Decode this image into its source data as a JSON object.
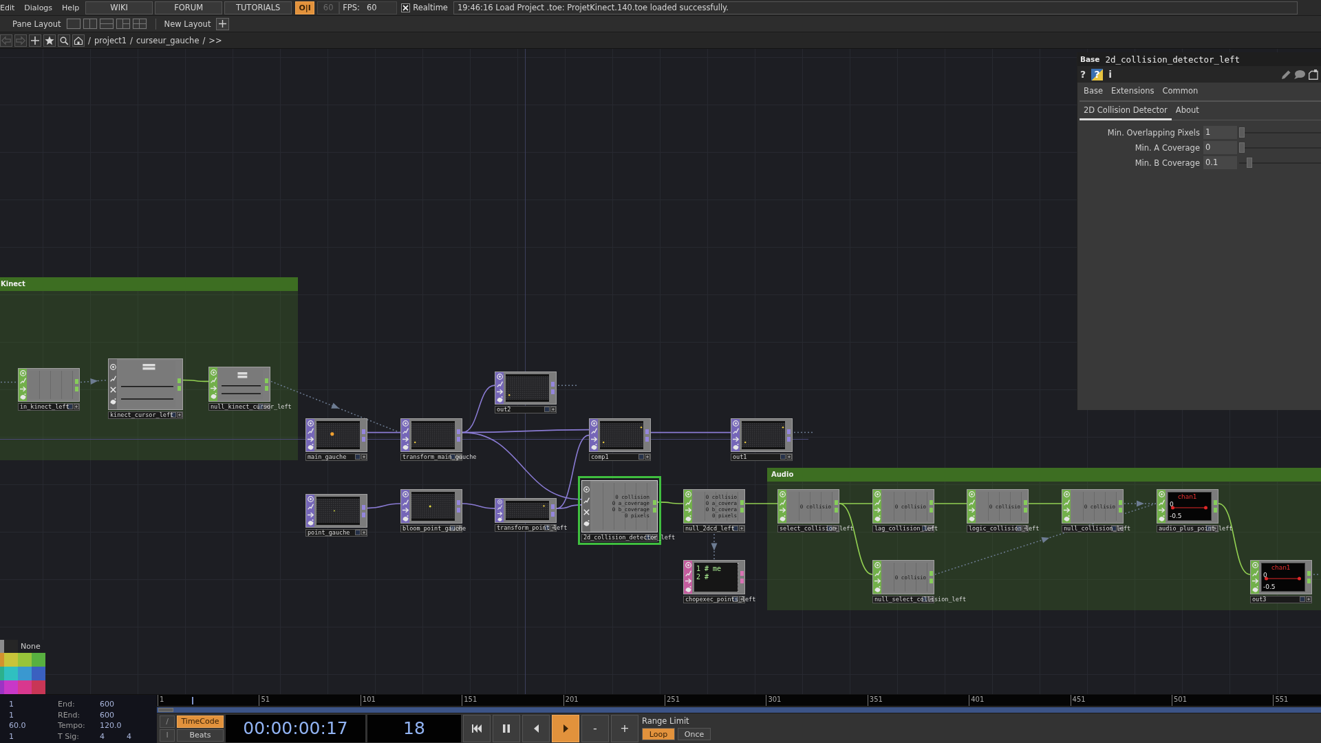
{
  "menu_bar": {
    "menus": [
      "Edit",
      "Dialogs",
      "Help"
    ],
    "links": [
      "WIKI",
      "FORUM",
      "TUTORIALS"
    ],
    "perform_toggle": {
      "label": "O|I",
      "on": true
    },
    "fps_limit": {
      "value": "60",
      "disabled": true
    },
    "fps": {
      "label": "FPS:",
      "value": "60"
    },
    "realtime": {
      "label": "Realtime",
      "checked": true
    },
    "message": "19:46:16 Load Project .toe: ProjetKinect.140.toe loaded successfully."
  },
  "pane_bar": {
    "label": "Pane Layout",
    "new_layout": "New Layout"
  },
  "path_bar": {
    "nav": [
      {
        "kind": "back",
        "disabled": true
      },
      {
        "kind": "forward",
        "disabled": true
      },
      {
        "kind": "add",
        "disabled": false
      },
      {
        "kind": "star",
        "disabled": false
      },
      {
        "kind": "find",
        "disabled": false
      },
      {
        "kind": "home",
        "disabled": false
      }
    ],
    "path": [
      "/",
      "project1",
      "/",
      "curseur_gauche",
      "/",
      ">>"
    ]
  },
  "network": {
    "annotations": [
      {
        "title": "Kinect"
      },
      {
        "title": "Audio"
      }
    ],
    "nodes": [
      {
        "name": "in_kinect_left",
        "kind": "chop",
        "viewer": {
          "kind": "channels"
        },
        "selected": false
      },
      {
        "name": "kinect_cursor_left",
        "kind": "comp",
        "viewer": {
          "kind": "panel"
        },
        "selected": false
      },
      {
        "name": "null_kinect_cursor_left",
        "kind": "chop",
        "viewer": {
          "kind": "panel"
        },
        "selected": false
      },
      {
        "name": "out2",
        "kind": "top",
        "viewer": {
          "kind": "image"
        },
        "selected": false
      },
      {
        "name": "main_gauche",
        "kind": "top",
        "viewer": {
          "kind": "image"
        },
        "selected": false
      },
      {
        "name": "transform_main_gauche",
        "kind": "top",
        "viewer": {
          "kind": "image"
        },
        "selected": false
      },
      {
        "name": "comp1",
        "kind": "top",
        "viewer": {
          "kind": "image"
        },
        "selected": false
      },
      {
        "name": "out1",
        "kind": "top",
        "viewer": {
          "kind": "image"
        },
        "selected": false
      },
      {
        "name": "point_gauche",
        "kind": "top",
        "viewer": {
          "kind": "image"
        },
        "selected": false
      },
      {
        "name": "bloom_point_gauche",
        "kind": "top",
        "viewer": {
          "kind": "image"
        },
        "selected": false
      },
      {
        "name": "transform_point_left",
        "kind": "top",
        "viewer": {
          "kind": "image"
        },
        "selected": false
      },
      {
        "name": "2d_collision_detector_left",
        "kind": "comp",
        "viewer": {
          "kind": "channels",
          "lines": [
            "0 collision",
            "0 a_coverage",
            "0 b_coverage",
            "0 pixels"
          ]
        },
        "selected": true
      },
      {
        "name": "null_2dcd_left",
        "kind": "chop",
        "viewer": {
          "kind": "channels",
          "lines": [
            "0 collisio",
            "0 a_covera",
            "0 b_covera",
            "0 pixels"
          ]
        },
        "selected": false
      },
      {
        "name": "chopexec_points_left",
        "kind": "dat",
        "viewer": {
          "kind": "table",
          "lines": [
            "1 # me",
            "2 #"
          ]
        },
        "selected": false
      },
      {
        "name": "select_collision_left",
        "kind": "chop",
        "viewer": {
          "kind": "channels",
          "lines": [
            "0 collisio"
          ]
        },
        "selected": false
      },
      {
        "name": "lag_collision_left",
        "kind": "chop",
        "viewer": {
          "kind": "channels",
          "lines": [
            "0 collisio"
          ]
        },
        "selected": false
      },
      {
        "name": "logic_collision_left",
        "kind": "chop",
        "viewer": {
          "kind": "channels",
          "lines": [
            "0 collisio"
          ]
        },
        "selected": false
      },
      {
        "name": "null_collision_left",
        "kind": "chop",
        "viewer": {
          "kind": "channels",
          "lines": [
            "0 collisio"
          ]
        },
        "selected": false
      },
      {
        "name": "audio_plus_point_left",
        "kind": "chop",
        "viewer": {
          "kind": "graph",
          "lines": [
            "chan1",
            "0",
            "-0.5"
          ]
        },
        "selected": false
      },
      {
        "name": "null_select_collision_left",
        "kind": "chop",
        "viewer": {
          "kind": "channels",
          "lines": [
            "0 collisio"
          ]
        },
        "selected": false
      },
      {
        "name": "out3",
        "kind": "chop",
        "viewer": {
          "kind": "graph",
          "lines": [
            "chan1",
            "0",
            "-0.5"
          ]
        },
        "selected": false
      }
    ]
  },
  "parameters": {
    "type": "Base",
    "name": "2d_collision_detector_left",
    "help": [
      {
        "kind": "help",
        "label": "?"
      },
      {
        "kind": "python",
        "label": "?"
      },
      {
        "kind": "info",
        "label": "i"
      }
    ],
    "page_rows": [
      {
        "tabs": [
          {
            "label": "Base",
            "selected": false
          },
          {
            "label": "Extensions",
            "selected": false
          },
          {
            "label": "Common",
            "selected": false
          }
        ]
      },
      {
        "tabs": [
          {
            "label": "2D Collision Detector",
            "selected": true
          },
          {
            "label": "About",
            "selected": false
          }
        ]
      }
    ],
    "params": [
      {
        "label": "Min. Overlapping Pixels",
        "value": "1",
        "level": 0
      },
      {
        "label": "Min. A Coverage",
        "value": "0",
        "level": 0
      },
      {
        "label": "Min. B Coverage",
        "value": "0.1",
        "level": 0.1
      }
    ]
  },
  "palette": {
    "label": "None",
    "swatches": [
      {
        "color": "#8c8c8c"
      },
      {
        "color": "#262626"
      },
      {
        "color": "#d4922e"
      },
      {
        "color": "#c8c43a"
      },
      {
        "color": "#98c43a"
      },
      {
        "color": "#58b040"
      },
      {
        "color": "#2cb08c"
      },
      {
        "color": "#30c0c0"
      },
      {
        "color": "#3a98d0"
      },
      {
        "color": "#3a60c0"
      },
      {
        "color": "#9c34c4"
      },
      {
        "color": "#c838c8"
      },
      {
        "color": "#d8388e"
      },
      {
        "color": "#c83656"
      }
    ]
  },
  "timeline": {
    "info": [
      {
        "column_1": "1",
        "label": "End:",
        "values": [
          "600"
        ]
      },
      {
        "column_1": "1",
        "label": "REnd:",
        "values": [
          "600"
        ]
      },
      {
        "column_1": "60.0",
        "label": "Tempo:",
        "values": [
          "120.0"
        ]
      },
      {
        "column_1": "1",
        "label": "T Sig:",
        "values": [
          "4",
          "4"
        ]
      }
    ],
    "ruler": {
      "ticks": [
        "1",
        "51",
        "101",
        "151",
        "201",
        "251",
        "301",
        "351",
        "401",
        "451",
        "501",
        "551"
      ],
      "level": 0.03
    },
    "side_buttons": [
      "/",
      "I"
    ],
    "time_modes": [
      {
        "label": "TimeCode",
        "selected": true
      },
      {
        "label": "Beats",
        "selected": false
      }
    ],
    "timecode": "00:00:00:17",
    "frame": "18",
    "transport": [
      {
        "kind": "rewind",
        "on": false
      },
      {
        "kind": "pause",
        "on": false
      },
      {
        "kind": "step_back",
        "on": false
      },
      {
        "kind": "play",
        "on": true
      },
      {
        "kind": "text",
        "label": "-",
        "on": false
      },
      {
        "kind": "text",
        "label": "+",
        "on": false
      }
    ],
    "range": {
      "label": "Range Limit",
      "modes": [
        {
          "label": "Loop",
          "selected": true
        },
        {
          "label": "Once",
          "selected": false
        }
      ]
    }
  }
}
